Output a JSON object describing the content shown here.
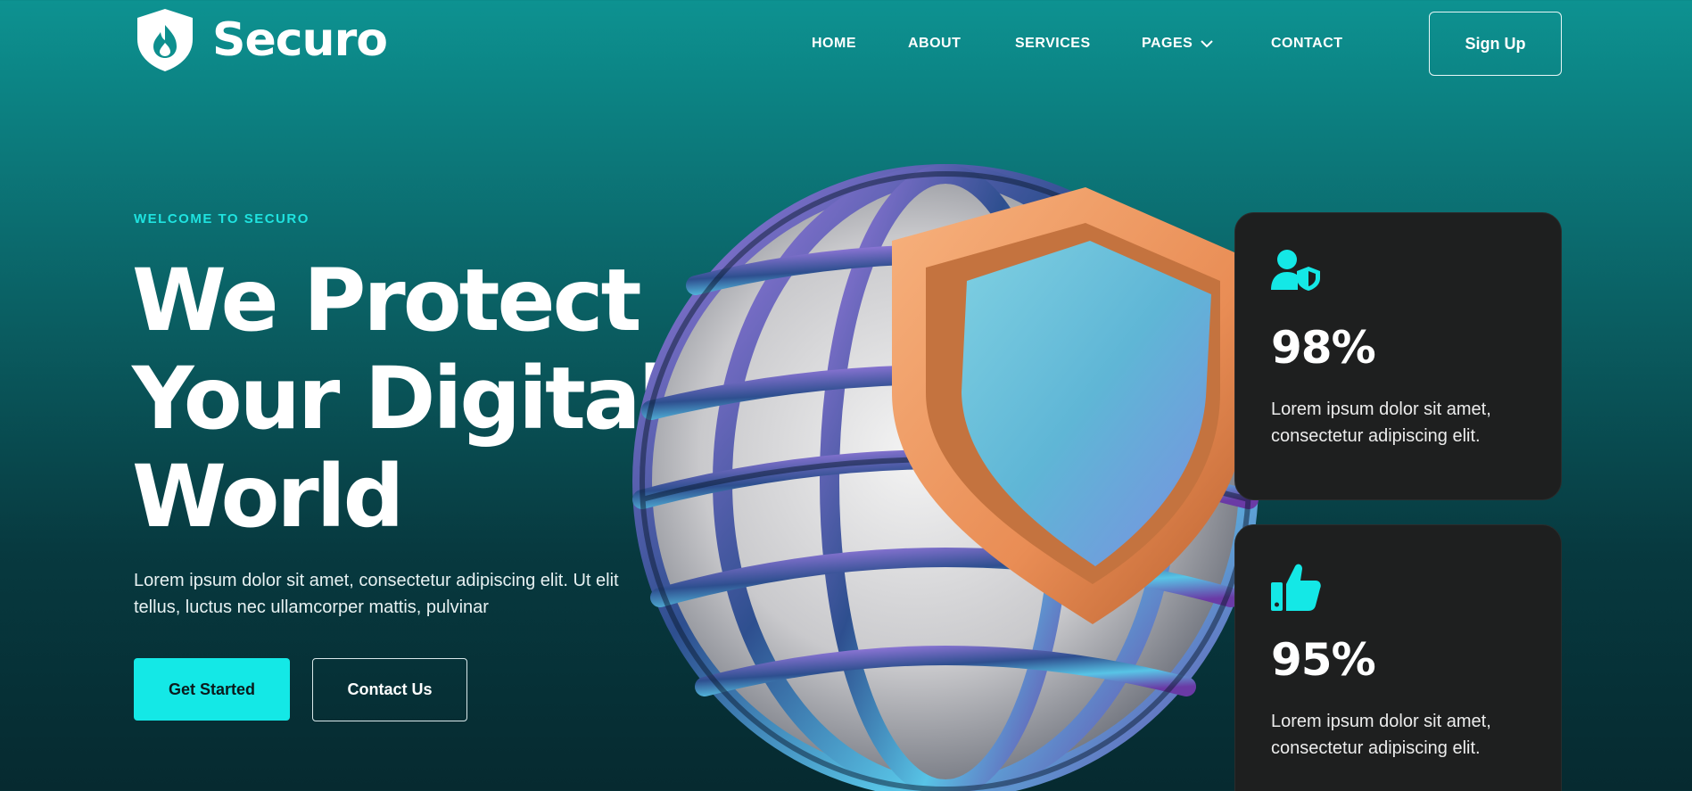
{
  "brand": {
    "name": "Securo",
    "logo_icon": "shield-flame-icon"
  },
  "nav": {
    "items": [
      {
        "label": "HOME"
      },
      {
        "label": "ABOUT"
      },
      {
        "label": "SERVICES"
      },
      {
        "label": "PAGES",
        "has_dropdown": true
      },
      {
        "label": "CONTACT"
      }
    ],
    "cta": "Sign Up"
  },
  "hero": {
    "eyebrow": "WELCOME TO SECURO",
    "headline": [
      "We Protect",
      "Your Digital",
      "World"
    ],
    "description": "Lorem ipsum dolor sit amet, consectetur adipiscing elit. Ut elit tellus, luctus nec ullamcorper mattis, pulvinar",
    "primary_button": "Get Started",
    "secondary_button": "Contact Us"
  },
  "stats": [
    {
      "icon": "user-shield-icon",
      "value": "98%",
      "text": "Lorem ipsum dolor sit amet, consectetur adipiscing elit."
    },
    {
      "icon": "thumbs-up-icon",
      "value": "95%",
      "text": "Lorem ipsum dolor sit amet, consectetur adipiscing elit."
    }
  ],
  "colors": {
    "accent": "#14e8e6",
    "card_bg": "#1e1f1f",
    "bg_top": "#0d9291",
    "bg_bottom": "#062a30",
    "shield_orange": "#f2a36b"
  }
}
